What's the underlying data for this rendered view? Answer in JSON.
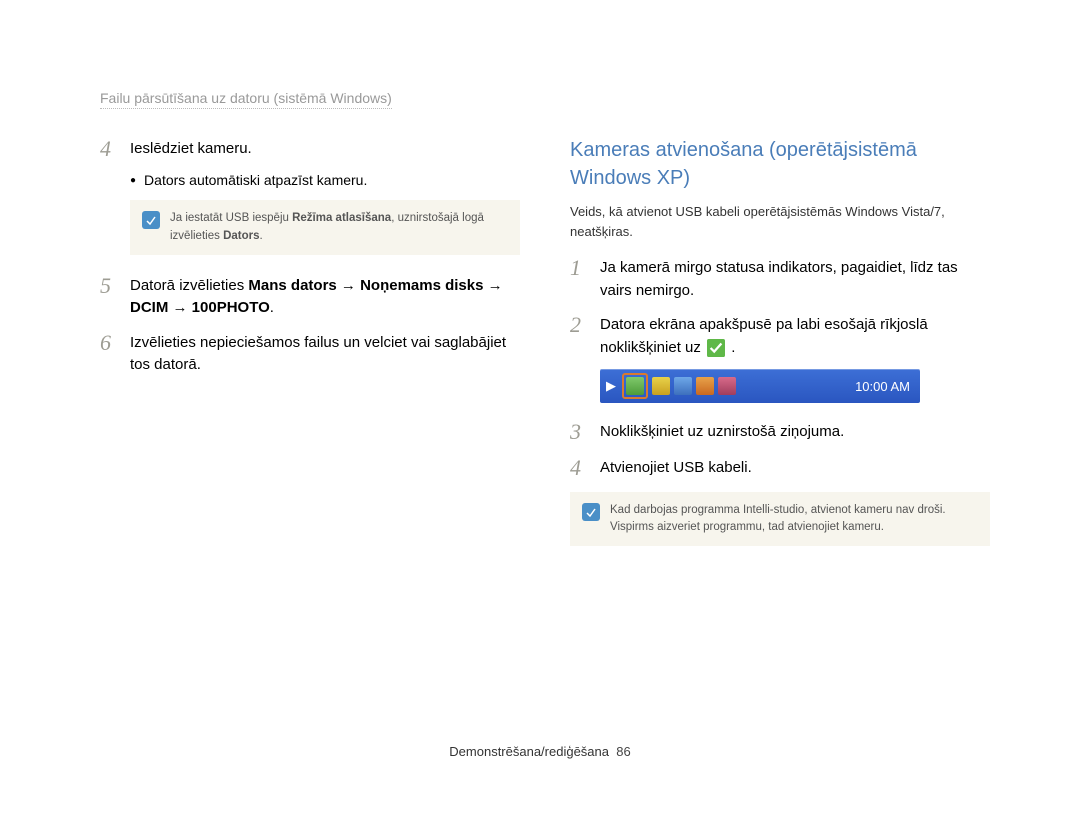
{
  "breadcrumb": "Failu pārsūtīšana uz datoru (sistēmā Windows)",
  "left": {
    "step4": {
      "num": "4",
      "text": "Ieslēdziet kameru."
    },
    "bullet4": "Dators automātiski atpazīst kameru.",
    "note4_pre": "Ja iestatāt USB iespēju ",
    "note4_bold1": "Režīma atlasīšana",
    "note4_mid": ", uznirstošajā logā izvēlieties ",
    "note4_bold2": "Dators",
    "note4_post": ".",
    "step5": {
      "num": "5",
      "text_pre": "Datorā izvēlieties ",
      "bold": "Mans dators → Noņemams disks → DCIM → 100PHOTO",
      "text_post": "."
    },
    "step6": {
      "num": "6",
      "text": "Izvēlieties nepieciešamos failus un velciet vai saglabājiet tos datorā."
    }
  },
  "right": {
    "title": "Kameras atvienošana (operētājsistēmā Windows XP)",
    "subtext": "Veids, kā atvienot USB kabeli operētājsistēmās Windows Vista/7, neatšķiras.",
    "step1": {
      "num": "1",
      "text": "Ja kamerā mirgo statusa indikators, pagaidiet, līdz tas vairs nemirgo."
    },
    "step2": {
      "num": "2",
      "text_pre": "Datora ekrāna apakšpusē pa labi esošajā rīkjoslā noklikšķiniet uz ",
      "text_post": "."
    },
    "taskbar_time": "10:00 AM",
    "step3": {
      "num": "3",
      "text": "Noklikšķiniet uz uznirstošā ziņojuma."
    },
    "step4": {
      "num": "4",
      "text": "Atvienojiet USB kabeli."
    },
    "note": "Kad darbojas programma Intelli-studio, atvienot kameru nav droši. Vispirms aizveriet programmu, tad atvienojiet kameru."
  },
  "footer": {
    "section": "Demonstrēšana/rediģēšana",
    "page": "86"
  }
}
